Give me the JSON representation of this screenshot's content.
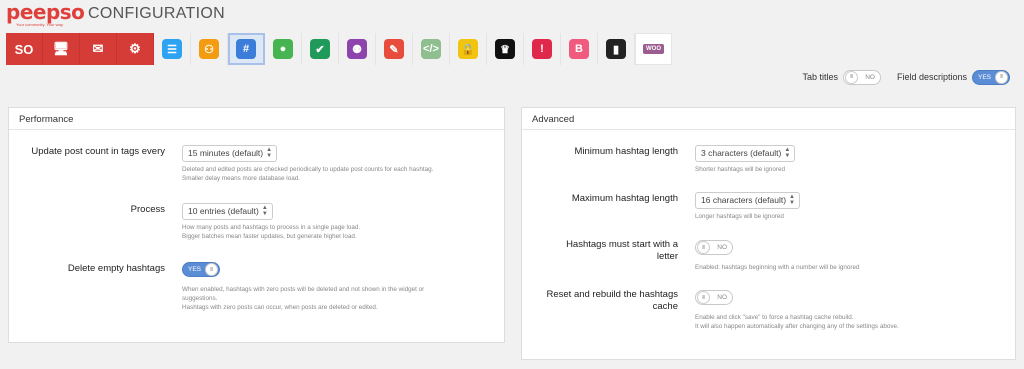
{
  "brand": {
    "name": "peepso",
    "tagline": "Your community. Your way."
  },
  "page": {
    "title": "CONFIGURATION"
  },
  "tabs": [
    {
      "name": "tab-general",
      "icon": "so-badge",
      "glyph": "SO",
      "bg": "#d63c37",
      "core": true
    },
    {
      "name": "tab-appearance",
      "icon": "monitor-icon",
      "glyph": "🖥",
      "bg": "#d63c37",
      "core": true
    },
    {
      "name": "tab-emails",
      "icon": "envelope-gear-icon",
      "glyph": "✉",
      "bg": "#d63c37",
      "core": true
    },
    {
      "name": "tab-advanced",
      "icon": "gears-icon",
      "glyph": "⚙",
      "bg": "#d63c37",
      "core": true
    },
    {
      "name": "tab-chat",
      "icon": "chat-bubble-icon",
      "glyph": "☰",
      "bg": "#2ea3f2"
    },
    {
      "name": "tab-groups",
      "icon": "group-icon",
      "glyph": "⚇",
      "bg": "#f39c12"
    },
    {
      "name": "tab-hashtags",
      "icon": "hashtag-icon",
      "glyph": "#",
      "bg": "#3b7dd8",
      "active": true
    },
    {
      "name": "tab-photos",
      "icon": "camera-icon",
      "glyph": "●",
      "bg": "#46b450"
    },
    {
      "name": "tab-polls",
      "icon": "checkbox-icon",
      "glyph": "✔",
      "bg": "#1f9a5b"
    },
    {
      "name": "tab-friends",
      "icon": "users-icon",
      "glyph": "⚉",
      "bg": "#8e44ad"
    },
    {
      "name": "tab-editor",
      "icon": "pencil-icon",
      "glyph": "✎",
      "bg": "#e74c3c"
    },
    {
      "name": "tab-embeds",
      "icon": "code-icon",
      "glyph": "</>",
      "bg": "#8fbf8f"
    },
    {
      "name": "tab-privacy",
      "icon": "lock-icon",
      "glyph": "🔒",
      "bg": "#f1c40f"
    },
    {
      "name": "tab-badges",
      "icon": "crown-icon",
      "glyph": "♛",
      "bg": "#111111"
    },
    {
      "name": "tab-messages",
      "icon": "alert-chat-icon",
      "glyph": "!",
      "bg": "#e0284b"
    },
    {
      "name": "tab-blogposts",
      "icon": "blog-icon",
      "glyph": "B",
      "bg": "#f05a7e"
    },
    {
      "name": "tab-pages",
      "icon": "page-icon",
      "glyph": "▮",
      "bg": "#222222"
    },
    {
      "name": "tab-woocommerce",
      "icon": "woo-icon",
      "glyph": "WOO",
      "bg": "#9b5c8f"
    }
  ],
  "view_toggles": {
    "tab_titles": {
      "label": "Tab titles",
      "state": "NO"
    },
    "field_descriptions": {
      "label": "Field descriptions",
      "state": "YES"
    }
  },
  "switch_knob": "III",
  "performance": {
    "title": "Performance",
    "update_count": {
      "label": "Update post count in tags every",
      "value": "15 minutes (default)",
      "help": "Deleted and edited posts are checked periodically to update post counts for each hashtag.\nSmaller delay means more database load."
    },
    "process": {
      "label": "Process",
      "value": "10 entries (default)",
      "help": "How many posts and hashtags to process in a single page load.\nBigger batches mean faster updates, but generate higher load."
    },
    "delete_empty": {
      "label": "Delete empty hashtags",
      "state": "YES",
      "help": "When enabled, hashtags with zero posts will be deleted and not shown in the widget or\nsuggestions.\nHashtags with zero posts can occur, when posts are deleted or edited."
    }
  },
  "advanced": {
    "title": "Advanced",
    "min_length": {
      "label": "Minimum hashtag length",
      "value": "3 characters (default)",
      "help": "Shorter hashtags will be ignored"
    },
    "max_length": {
      "label": "Maximum hashtag length",
      "value": "16 characters (default)",
      "help": "Longer hashtags will be ignored"
    },
    "must_start_letter": {
      "label": "Hashtags must start with a\nletter",
      "state": "NO",
      "help": "Enabled: hashtags beginning with a number will be ignored"
    },
    "rebuild_cache": {
      "label": "Reset and rebuild the hashtags\ncache",
      "state": "NO",
      "help": "Enable and click \"save\" to force a hashtag cache rebuild.\nIt will also happen automatically after changing any of the settings above."
    }
  }
}
